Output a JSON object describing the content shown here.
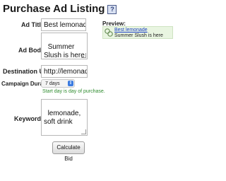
{
  "header": {
    "title": "Purchase Ad Listing",
    "help_icon": "?"
  },
  "form": {
    "ad_title": {
      "label": "Ad Title:",
      "value": "Best lemonade"
    },
    "ad_body": {
      "label": "Ad Body :",
      "value": "Summer Slush is here"
    },
    "destination_url": {
      "label": "Destination URL:",
      "value": "http://lemonade.com"
    },
    "campaign_duration": {
      "label": "Campaign Duration:",
      "selected": "7 days",
      "note": "Start day is day of purchase."
    },
    "keywords": {
      "label": "Keywords:",
      "value": "lemonade, soft drink"
    },
    "calculate_button": "Calculate Bid"
  },
  "preview": {
    "label": "Preview:",
    "ad_title": "Best lemonade",
    "ad_body": "Summer Slush is here",
    "icon": "link-chain-icon"
  },
  "colors": {
    "note_green": "#2e8b2e",
    "link_blue": "#1a3ec2",
    "preview_bg": "#e9f5e1",
    "select_accent": "#3b7be0"
  }
}
